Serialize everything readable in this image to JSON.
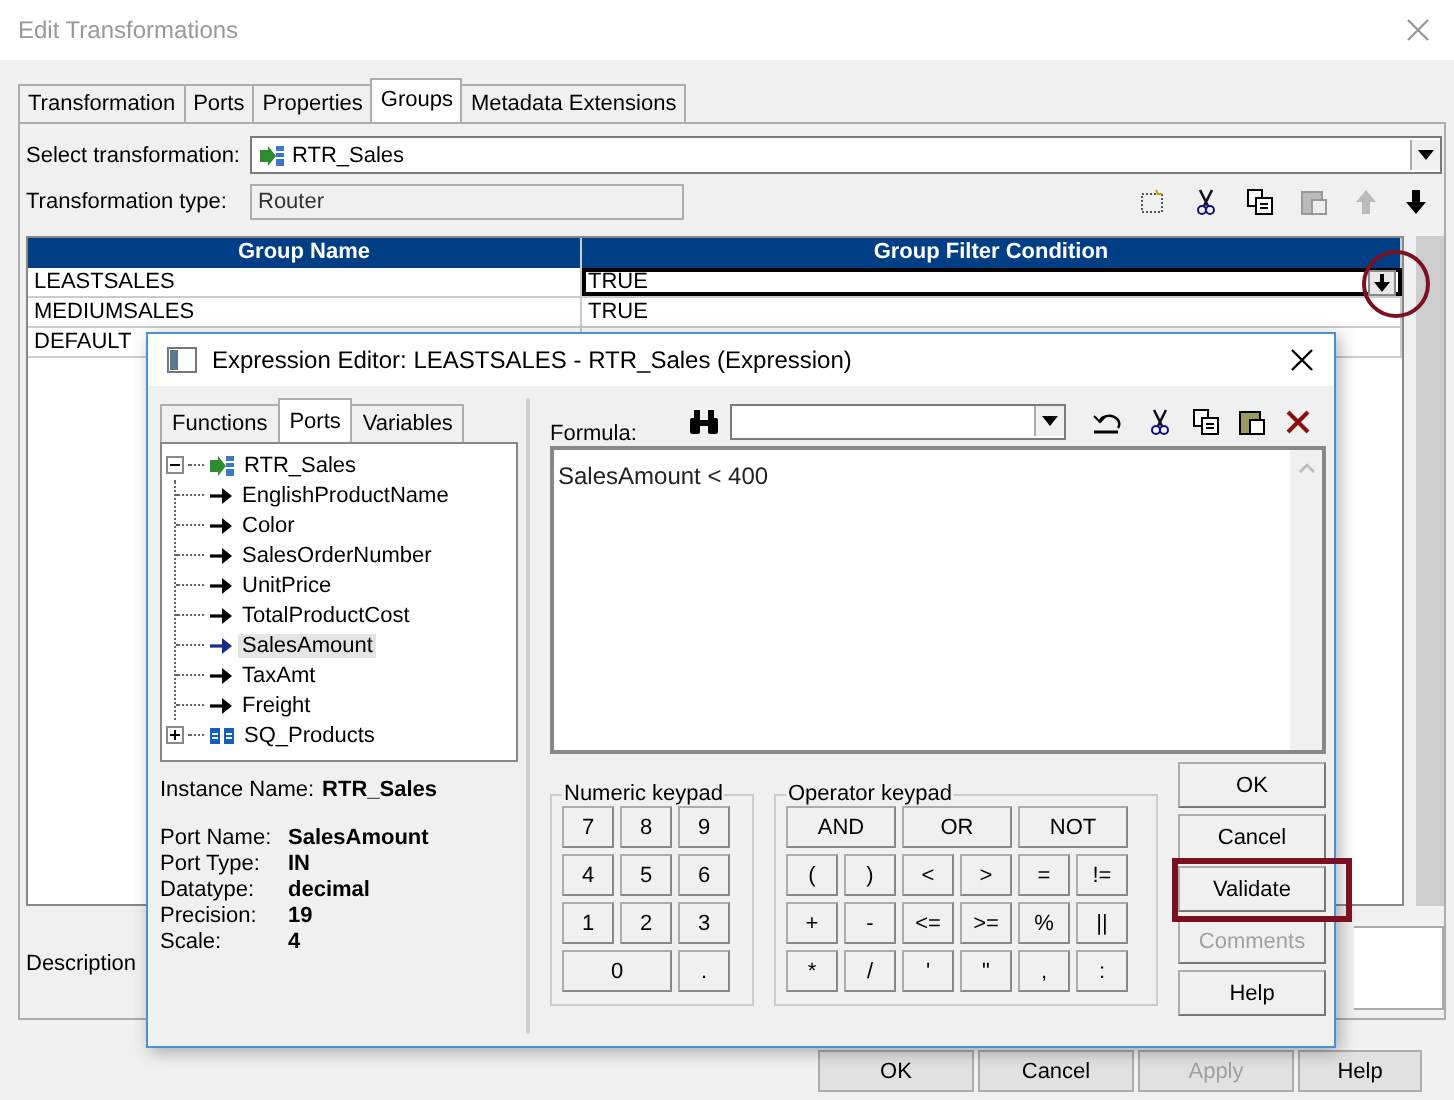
{
  "window": {
    "title": "Edit Transformations"
  },
  "tabs": [
    {
      "label": "Transformation",
      "selected": false
    },
    {
      "label": "Ports",
      "selected": false
    },
    {
      "label": "Properties",
      "selected": false
    },
    {
      "label": "Groups",
      "selected": true
    },
    {
      "label": "Metadata Extensions",
      "selected": false
    }
  ],
  "select_transformation": {
    "label": "Select transformation:",
    "value": "RTR_Sales"
  },
  "transformation_type": {
    "label": "Transformation type:",
    "value": "Router"
  },
  "groups_table": {
    "columns": [
      "Group Name",
      "Group Filter Condition"
    ],
    "rows": [
      {
        "group_name": "LEASTSALES",
        "condition": "TRUE",
        "editing": true
      },
      {
        "group_name": "MEDIUMSALES",
        "condition": "TRUE",
        "editing": false
      },
      {
        "group_name": "DEFAULT",
        "editing": false
      }
    ]
  },
  "description": {
    "label": "Description"
  },
  "buttons": [
    {
      "label": "OK",
      "disabled": false
    },
    {
      "label": "Cancel",
      "disabled": false
    },
    {
      "label": "Apply",
      "disabled": true
    },
    {
      "label": "Help",
      "disabled": false
    }
  ],
  "expression_editor": {
    "title": "Expression Editor: LEASTSALES - RTR_Sales (Expression)",
    "tabs": [
      {
        "label": "Functions",
        "selected": false
      },
      {
        "label": "Ports",
        "selected": true
      },
      {
        "label": "Variables",
        "selected": false
      }
    ],
    "tree": [
      {
        "label": "RTR_Sales",
        "kind": "router",
        "expanded": true,
        "children": [
          {
            "label": "EnglishProductName",
            "selected": false
          },
          {
            "label": "Color",
            "selected": false
          },
          {
            "label": "SalesOrderNumber",
            "selected": false
          },
          {
            "label": "UnitPrice",
            "selected": false
          },
          {
            "label": "TotalProductCost",
            "selected": false
          },
          {
            "label": "SalesAmount",
            "selected": true
          },
          {
            "label": "TaxAmt",
            "selected": false
          },
          {
            "label": "Freight",
            "selected": false
          }
        ]
      },
      {
        "label": "SQ_Products",
        "kind": "source_qualifier",
        "expanded": false
      }
    ],
    "instance": {
      "label": "Instance Name:",
      "value": "RTR_Sales"
    },
    "port_info": [
      {
        "label": "Port Name:",
        "value": "SalesAmount"
      },
      {
        "label": "Port Type:",
        "value": "IN"
      },
      {
        "label": "Datatype:",
        "value": "decimal"
      },
      {
        "label": "Precision:",
        "value": "19"
      },
      {
        "label": "Scale:",
        "value": "4"
      }
    ],
    "formula_label": "Formula:",
    "formula": "SalesAmount < 400",
    "numeric_keypad": {
      "title": "Numeric keypad",
      "keys": [
        {
          "label": "7",
          "wide": false
        },
        {
          "label": "8",
          "wide": false
        },
        {
          "label": "9",
          "wide": false
        },
        {
          "label": "4",
          "wide": false
        },
        {
          "label": "5",
          "wide": false
        },
        {
          "label": "6",
          "wide": false
        },
        {
          "label": "1",
          "wide": false
        },
        {
          "label": "2",
          "wide": false
        },
        {
          "label": "3",
          "wide": false
        },
        {
          "label": "0",
          "wide": true
        },
        {
          "label": ".",
          "wide": false
        }
      ]
    },
    "operator_keypad": {
      "title": "Operator keypad",
      "keys": [
        {
          "label": "AND",
          "wide": true
        },
        {
          "label": "OR",
          "wide": true
        },
        {
          "label": "NOT",
          "wide": true
        },
        {
          "label": "(",
          "wide": false
        },
        {
          "label": ")",
          "wide": false
        },
        {
          "label": "<",
          "wide": false
        },
        {
          "label": ">",
          "wide": false
        },
        {
          "label": "=",
          "wide": false
        },
        {
          "label": "!=",
          "wide": false
        },
        {
          "label": "+",
          "wide": false
        },
        {
          "label": "-",
          "wide": false
        },
        {
          "label": "<=",
          "wide": false
        },
        {
          "label": ">=",
          "wide": false
        },
        {
          "label": "%",
          "wide": false
        },
        {
          "label": "||",
          "wide": false
        },
        {
          "label": "*",
          "wide": false
        },
        {
          "label": "/",
          "wide": false
        },
        {
          "label": "'",
          "wide": false
        },
        {
          "label": "\"",
          "wide": false
        },
        {
          "label": ",",
          "wide": false
        },
        {
          "label": ":",
          "wide": false
        }
      ]
    },
    "buttons": [
      {
        "label": "OK",
        "disabled": false
      },
      {
        "label": "Cancel",
        "disabled": false
      },
      {
        "label": "Validate",
        "disabled": false
      },
      {
        "label": "Comments",
        "disabled": true
      },
      {
        "label": "Help",
        "disabled": false
      }
    ]
  }
}
